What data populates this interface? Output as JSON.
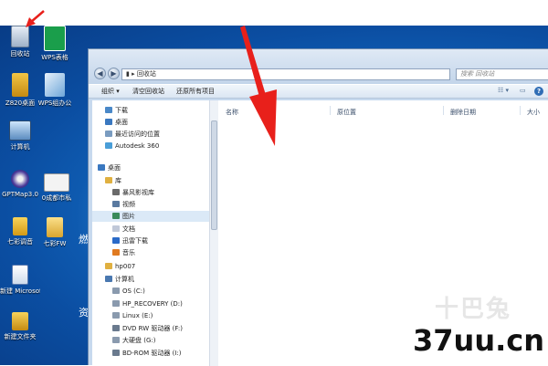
{
  "desktop": {
    "icons": [
      {
        "label": "回收站",
        "icon": "recycle-bin-icon"
      },
      {
        "label": "WPS表格",
        "icon": "wps-spreadsheet-icon"
      },
      {
        "label": "Z820桌面",
        "icon": "z820-icon"
      },
      {
        "label": "WPS组办公",
        "icon": "wps-office-icon"
      },
      {
        "label": "计算机",
        "icon": "computer-icon"
      },
      {
        "label": "GPTMap3.0",
        "icon": "gptmap-icon"
      },
      {
        "label": "0成都市私",
        "icon": "folder-icon"
      },
      {
        "label": "七彩调音",
        "icon": "music-icon"
      },
      {
        "label": "七彩FW",
        "icon": "folder-icon"
      },
      {
        "label": "新建 Microsoft",
        "icon": "word-doc-icon"
      },
      {
        "label": "新建文件夹",
        "icon": "folder-icon"
      }
    ],
    "side_text": [
      "燃",
      "资"
    ]
  },
  "window": {
    "address": "回收站",
    "search_placeholder": "搜索 回收站",
    "toolbar": {
      "organize": "组织 ▾",
      "empty_recycle_bin": "清空回收站",
      "restore_all": "还原所有项目"
    },
    "nav": [
      {
        "label": "下载",
        "icon": "download-folder-icon",
        "indent": 1
      },
      {
        "label": "桌面",
        "icon": "desktop-folder-icon",
        "indent": 1
      },
      {
        "label": "最近访问的位置",
        "icon": "recent-places-icon",
        "indent": 1
      },
      {
        "label": "Autodesk 360",
        "icon": "cloud-icon",
        "indent": 1
      },
      {
        "label": "桌面",
        "icon": "desktop-folder-icon",
        "indent": 0
      },
      {
        "label": "库",
        "icon": "library-icon",
        "indent": 1
      },
      {
        "label": "暴风影视库",
        "icon": "video-library-icon",
        "indent": 2
      },
      {
        "label": "视频",
        "icon": "video-folder-icon",
        "indent": 2
      },
      {
        "label": "图片",
        "icon": "pictures-folder-icon",
        "indent": 2,
        "selected": true
      },
      {
        "label": "文档",
        "icon": "documents-folder-icon",
        "indent": 2
      },
      {
        "label": "迅雷下载",
        "icon": "thunder-icon",
        "indent": 2
      },
      {
        "label": "音乐",
        "icon": "music-folder-icon",
        "indent": 2
      },
      {
        "label": "hp007",
        "icon": "user-folder-icon",
        "indent": 1
      },
      {
        "label": "计算机",
        "icon": "computer-icon",
        "indent": 1
      },
      {
        "label": "OS (C:)",
        "icon": "drive-icon",
        "indent": 2
      },
      {
        "label": "HP_RECOVERY (D:)",
        "icon": "drive-icon",
        "indent": 2
      },
      {
        "label": "Linux (E:)",
        "icon": "drive-icon",
        "indent": 2
      },
      {
        "label": "DVD RW 驱动器 (F:)",
        "icon": "dvd-drive-icon",
        "indent": 2
      },
      {
        "label": "大硬盘 (G:)",
        "icon": "drive-icon",
        "indent": 2
      },
      {
        "label": "BD-ROM 驱动器 (I:)",
        "icon": "bd-drive-icon",
        "indent": 2
      }
    ],
    "columns": [
      "名称",
      "原位置",
      "删除日期",
      "大小"
    ]
  },
  "watermark": {
    "brand": "十巴兔",
    "site": "37uu.cn"
  },
  "colors": {
    "accent_arrow": "#e8201b",
    "desktop_blue": "#1470c8"
  }
}
